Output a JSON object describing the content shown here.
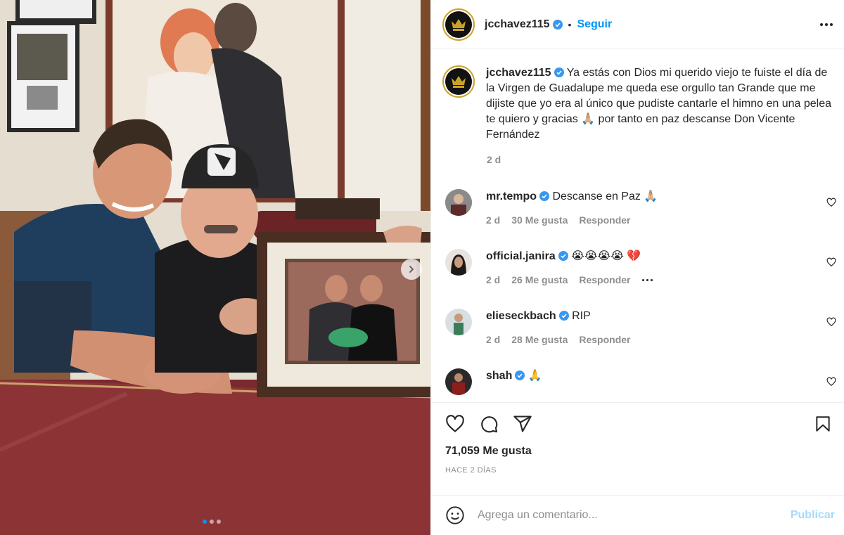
{
  "post": {
    "author": "jcchavez115",
    "follow_label": "Seguir",
    "separator": "•",
    "caption_author": "jcchavez115",
    "caption_text": "Ya estás con Dios mi querido viejo te fuiste el día de la Virgen de Guadalupe me queda ese orgullo tan Grande que me dijiste que yo era al único que pudiste cantarle el himno en una pelea te quiero y gracias 🙏🏼 por tanto en paz descanse Don Vicente Fernández",
    "caption_age": "2 d"
  },
  "comments": [
    {
      "user": "mr.tempo",
      "text": "Descanse en Paz 🙏🏼",
      "age": "2 d",
      "likes": "30 Me gusta",
      "reply": "Responder",
      "avatar_color": "#7a7a7a"
    },
    {
      "user": "official.janira",
      "text": "😭😭😭😭 💔",
      "age": "2 d",
      "likes": "26 Me gusta",
      "reply": "Responder",
      "avatar_color": "#2b2b2b"
    },
    {
      "user": "elieseckbach",
      "text": "RIP",
      "age": "2 d",
      "likes": "28 Me gusta",
      "reply": "Responder",
      "avatar_color": "#5d7a8a"
    },
    {
      "user": "shah",
      "text": "🙏",
      "avatar_color": "#1d1d1d"
    }
  ],
  "actions": {
    "likes_count": "71,059 Me gusta",
    "posted_time": "HACE 2 DÍAS"
  },
  "composer": {
    "placeholder": "Agrega un comentario...",
    "publish_label": "Publicar"
  },
  "carousel": {
    "total": 3,
    "current": 1
  },
  "colors": {
    "accent": "#0095f6",
    "verified": "#3897f0",
    "text": "#262626",
    "muted": "#8e8e8e"
  },
  "icons": [
    "heart-icon",
    "comment-icon",
    "share-icon",
    "bookmark-icon",
    "emoji-icon",
    "more-icon",
    "verified-icon",
    "chevron-right-icon"
  ]
}
